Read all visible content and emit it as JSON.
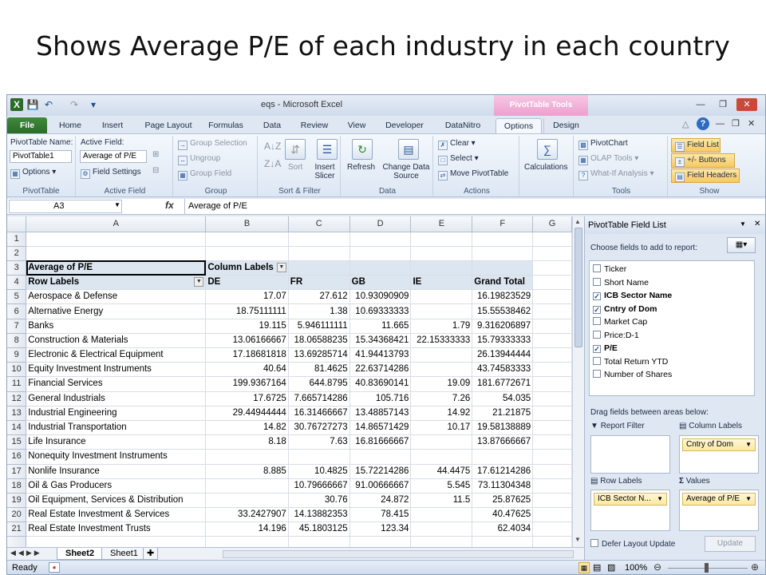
{
  "slide_title": "Shows Average P/E of each industry in each country",
  "window": {
    "title": "eqs - Microsoft Excel",
    "context_tab": "PivotTable Tools"
  },
  "tabs": [
    "File",
    "Home",
    "Insert",
    "Page Layout",
    "Formulas",
    "Data",
    "Review",
    "View",
    "Developer",
    "DataNitro",
    "Options",
    "Design"
  ],
  "active_tab": "Options",
  "ribbon": {
    "pivottable": {
      "name_label": "PivotTable Name:",
      "name_value": "PivotTable1",
      "options": "Options",
      "label": "PivotTable"
    },
    "active_field": {
      "label_text": "Active Field:",
      "value": "Average of P/E",
      "settings": "Field Settings",
      "label": "Active Field"
    },
    "group": {
      "group_selection": "Group Selection",
      "ungroup": "Ungroup",
      "group_field": "Group Field",
      "label": "Group"
    },
    "sort": {
      "sort": "Sort",
      "insert_slicer": "Insert Slicer",
      "label": "Sort & Filter"
    },
    "data": {
      "refresh": "Refresh",
      "change_source": "Change Data Source",
      "label": "Data"
    },
    "actions": {
      "clear": "Clear",
      "select": "Select",
      "move": "Move PivotTable",
      "label": "Actions"
    },
    "calculations": {
      "label": "Calculations"
    },
    "tools": {
      "pivotchart": "PivotChart",
      "olap": "OLAP Tools",
      "whatif": "What-If Analysis",
      "label": "Tools"
    },
    "show": {
      "field_list": "Field List",
      "buttons": "+/- Buttons",
      "headers": "Field Headers",
      "label": "Show"
    }
  },
  "formula_bar": {
    "name_box": "A3",
    "fx": "fx",
    "value": "Average of P/E"
  },
  "columns": [
    "A",
    "B",
    "C",
    "D",
    "E",
    "F",
    "G"
  ],
  "pivot": {
    "title_cell": "Average of P/E",
    "col_labels": "Column Labels",
    "row_labels": "Row Labels",
    "headers": [
      "DE",
      "FR",
      "GB",
      "IE",
      "Grand Total"
    ]
  },
  "rows": [
    {
      "n": "1",
      "label": "",
      "v": [
        "",
        "",
        "",
        "",
        ""
      ]
    },
    {
      "n": "2",
      "label": "",
      "v": [
        "",
        "",
        "",
        "",
        ""
      ]
    },
    {
      "n": "5",
      "label": "Aerospace & Defense",
      "v": [
        "17.07",
        "27.612",
        "10.93090909",
        "",
        "16.19823529"
      ]
    },
    {
      "n": "6",
      "label": "Alternative Energy",
      "v": [
        "18.75111111",
        "1.38",
        "10.69333333",
        "",
        "15.55538462"
      ]
    },
    {
      "n": "7",
      "label": "Banks",
      "v": [
        "19.115",
        "5.946111111",
        "11.665",
        "1.79",
        "9.316206897"
      ]
    },
    {
      "n": "8",
      "label": "Construction & Materials",
      "v": [
        "13.06166667",
        "18.06588235",
        "15.34368421",
        "22.15333333",
        "15.79333333"
      ]
    },
    {
      "n": "9",
      "label": "Electronic & Electrical Equipment",
      "v": [
        "17.18681818",
        "13.69285714",
        "41.94413793",
        "",
        "26.13944444"
      ]
    },
    {
      "n": "10",
      "label": "Equity Investment Instruments",
      "v": [
        "40.64",
        "81.4625",
        "22.63714286",
        "",
        "43.74583333"
      ]
    },
    {
      "n": "11",
      "label": "Financial Services",
      "v": [
        "199.9367164",
        "644.8795",
        "40.83690141",
        "19.09",
        "181.6772671"
      ]
    },
    {
      "n": "12",
      "label": "General Industrials",
      "v": [
        "17.6725",
        "7.665714286",
        "105.716",
        "7.26",
        "54.035"
      ]
    },
    {
      "n": "13",
      "label": "Industrial Engineering",
      "v": [
        "29.44944444",
        "16.31466667",
        "13.48857143",
        "14.92",
        "21.21875"
      ]
    },
    {
      "n": "14",
      "label": "Industrial Transportation",
      "v": [
        "14.82",
        "30.76727273",
        "14.86571429",
        "10.17",
        "19.58138889"
      ]
    },
    {
      "n": "15",
      "label": "Life Insurance",
      "v": [
        "8.18",
        "7.63",
        "16.81666667",
        "",
        "13.87666667"
      ]
    },
    {
      "n": "16",
      "label": "Nonequity Investment Instruments",
      "v": [
        "",
        "",
        "",
        "",
        ""
      ]
    },
    {
      "n": "17",
      "label": "Nonlife Insurance",
      "v": [
        "8.885",
        "10.4825",
        "15.72214286",
        "44.4475",
        "17.61214286"
      ]
    },
    {
      "n": "18",
      "label": "Oil & Gas Producers",
      "v": [
        "",
        "10.79666667",
        "91.00666667",
        "5.545",
        "73.11304348"
      ]
    },
    {
      "n": "19",
      "label": "Oil Equipment, Services & Distribution",
      "v": [
        "",
        "30.76",
        "24.872",
        "11.5",
        "25.87625"
      ]
    },
    {
      "n": "20",
      "label": "Real Estate Investment & Services",
      "v": [
        "33.2427907",
        "14.13882353",
        "78.415",
        "",
        "40.47625"
      ]
    },
    {
      "n": "21",
      "label": "Real Estate Investment Trusts",
      "v": [
        "14.196",
        "45.1803125",
        "123.34",
        "",
        "62.4034"
      ]
    }
  ],
  "sheet_tabs": [
    "Sheet2",
    "Sheet1"
  ],
  "status": {
    "ready": "Ready",
    "zoom": "100%"
  },
  "field_list": {
    "title": "PivotTable Field List",
    "choose": "Choose fields to add to report:",
    "fields": [
      {
        "name": "Ticker",
        "checked": false
      },
      {
        "name": "Short Name",
        "checked": false
      },
      {
        "name": "ICB Sector Name",
        "checked": true
      },
      {
        "name": "Cntry of Dom",
        "checked": true
      },
      {
        "name": "Market Cap",
        "checked": false
      },
      {
        "name": "Price:D-1",
        "checked": false
      },
      {
        "name": "P/E",
        "checked": true
      },
      {
        "name": "Total Return YTD",
        "checked": false
      },
      {
        "name": "Number of Shares",
        "checked": false
      }
    ],
    "drag": "Drag fields between areas below:",
    "report_filter": "Report Filter",
    "column_labels": "Column Labels",
    "row_labels": "Row Labels",
    "values": "Values",
    "col_chip": "Cntry of Dom",
    "row_chip": "ICB Sector N...",
    "val_chip": "Average of P/E",
    "defer": "Defer Layout Update",
    "update": "Update"
  }
}
